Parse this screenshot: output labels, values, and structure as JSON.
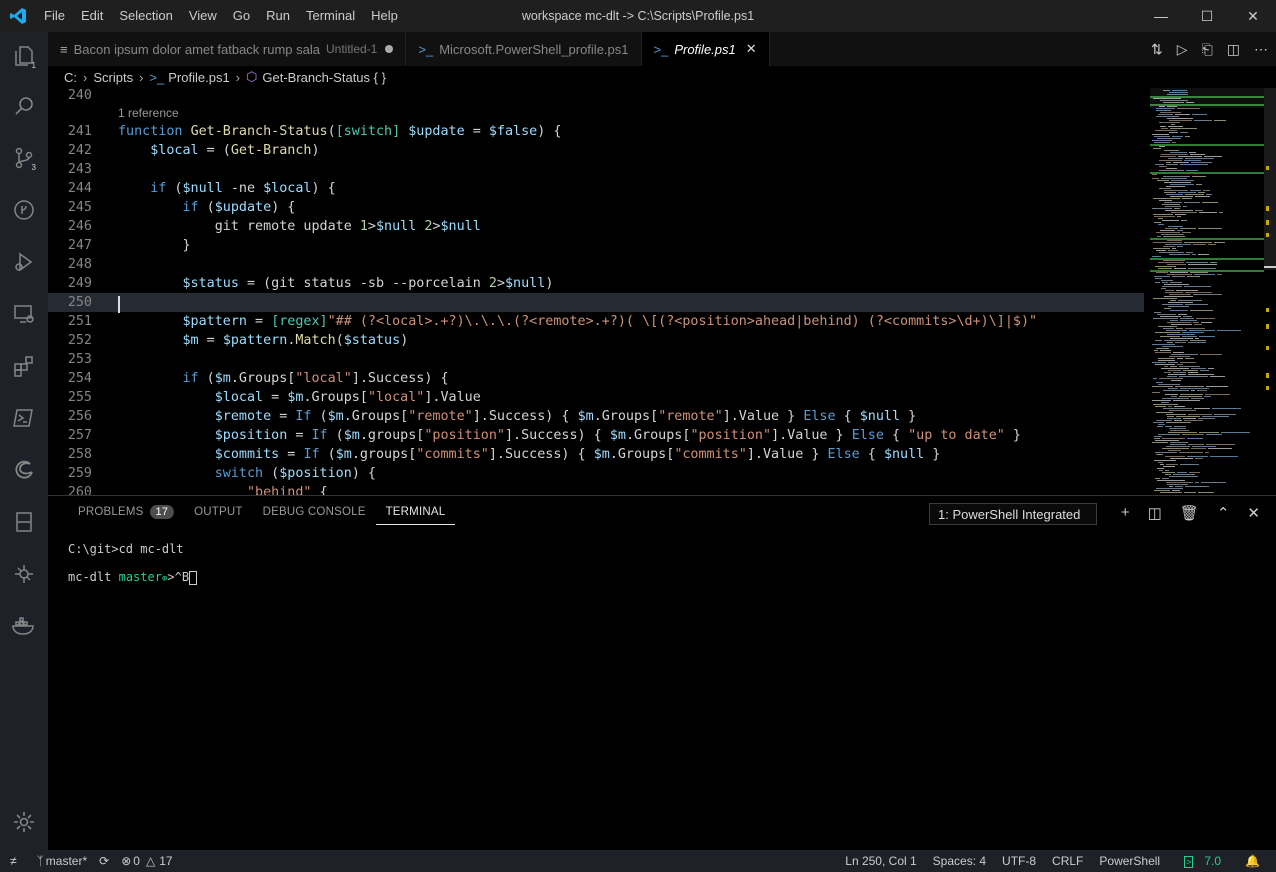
{
  "titlebar": {
    "menu": [
      "File",
      "Edit",
      "Selection",
      "View",
      "Go",
      "Run",
      "Terminal",
      "Help"
    ],
    "title": "workspace mc-dlt -> C:\\Scripts\\Profile.ps1"
  },
  "activity": {
    "explorer_badge": "1",
    "scm_badge": "3"
  },
  "tabs": [
    {
      "label": "Bacon ipsum dolor amet fatback rump sala",
      "extra": "Untitled-1"
    },
    {
      "label": "Microsoft.PowerShell_profile.ps1"
    },
    {
      "label": "Profile.ps1"
    }
  ],
  "breadcrumb": {
    "drive": "C:",
    "folder": "Scripts",
    "file": "Profile.ps1",
    "symbol": "Get-Branch-Status { }"
  },
  "code": {
    "reference": "1 reference",
    "lines": [
      {
        "n": "240",
        "t": ""
      },
      {
        "n": "241",
        "t": "function Get-Branch-Status([switch] $update = $false) {"
      },
      {
        "n": "242",
        "t": "    $local = (Get-Branch)"
      },
      {
        "n": "243",
        "t": ""
      },
      {
        "n": "244",
        "t": "    if ($null -ne $local) {"
      },
      {
        "n": "245",
        "t": "        if ($update) {"
      },
      {
        "n": "246",
        "t": "            git remote update 1>$null 2>$null"
      },
      {
        "n": "247",
        "t": "        }"
      },
      {
        "n": "248",
        "t": ""
      },
      {
        "n": "249",
        "t": "        $status = (git status -sb --porcelain 2>$null)"
      },
      {
        "n": "250",
        "t": ""
      },
      {
        "n": "251",
        "t": "        $pattern = [regex]\"## (?<local>.+?)\\.\\.\\.(?<remote>.+?)( \\[(?<position>ahead|behind) (?<commits>\\d+)\\]|$)\""
      },
      {
        "n": "252",
        "t": "        $m = $pattern.Match($status)"
      },
      {
        "n": "253",
        "t": ""
      },
      {
        "n": "254",
        "t": "        if ($m.Groups[\"local\"].Success) {"
      },
      {
        "n": "255",
        "t": "            $local = $m.Groups[\"local\"].Value"
      },
      {
        "n": "256",
        "t": "            $remote = If ($m.Groups[\"remote\"].Success) { $m.Groups[\"remote\"].Value } Else { $null }"
      },
      {
        "n": "257",
        "t": "            $position = If ($m.groups[\"position\"].Success) { $m.Groups[\"position\"].Value } Else { \"up to date\" }"
      },
      {
        "n": "258",
        "t": "            $commits = If ($m.groups[\"commits\"].Success) { $m.Groups[\"commits\"].Value } Else { $null }"
      },
      {
        "n": "259",
        "t": "            switch ($position) {"
      },
      {
        "n": "260",
        "t": "                \"behind\" {"
      }
    ]
  },
  "panel": {
    "tabs": [
      "PROBLEMS",
      "OUTPUT",
      "DEBUG CONSOLE",
      "TERMINAL"
    ],
    "problems_count": "17",
    "terminal_select": "1: PowerShell Integrated",
    "terminal": {
      "line1": "C:\\git>cd mc-dlt",
      "prompt_dir": "mc-dlt",
      "prompt_branch": "master",
      "prompt_symbol": "⊕",
      "prompt_rest": ">^B"
    }
  },
  "status": {
    "branch": "master*",
    "errors": "0",
    "warnings": "17",
    "position": "Ln 250, Col 1",
    "spaces": "Spaces: 4",
    "encoding": "UTF-8",
    "eol": "CRLF",
    "language": "PowerShell",
    "version": "7.0"
  }
}
